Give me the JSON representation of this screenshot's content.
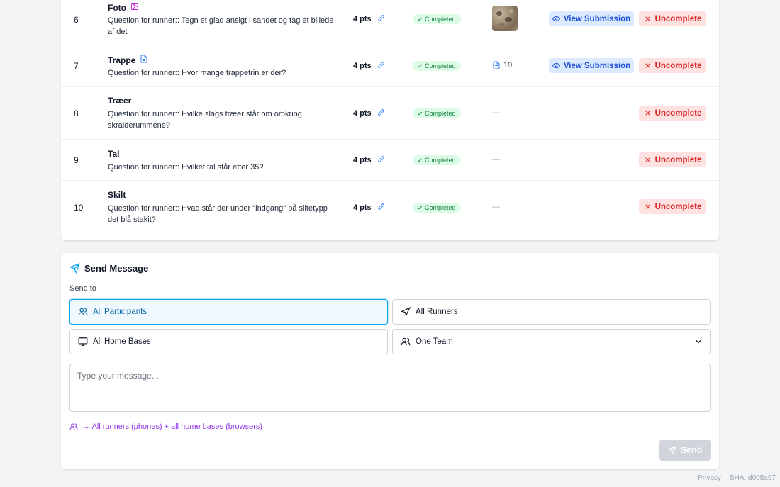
{
  "tasks": [
    {
      "number": "6",
      "title": "Foto",
      "type_icon": "image-icon",
      "question": "Question for runner:: Tegn et glad ansigt i sandet og tag et billede af det",
      "points": "4 pts",
      "status": "Completed",
      "submission_type": "photo-thumbnail",
      "submission_text": "",
      "view_label": "View Submission",
      "uncomplete_label": "Uncomplete"
    },
    {
      "number": "7",
      "title": "Trappe",
      "type_icon": "document-icon",
      "question": "Question for runner:: Hvor mange trappetrin er der?",
      "points": "4 pts",
      "status": "Completed",
      "submission_type": "text-answer",
      "submission_text": "19",
      "view_label": "View Submission",
      "uncomplete_label": "Uncomplete"
    },
    {
      "number": "8",
      "title": "Træer",
      "question": "Question for runner:: Hvilke slags træer står om omkring skralderummene?",
      "points": "4 pts",
      "status": "Completed",
      "submission_type": "none",
      "submission_text": "—",
      "uncomplete_label": "Uncomplete"
    },
    {
      "number": "9",
      "title": "Tal",
      "question": "Question for runner:: Hvilket tal står efter 35?",
      "points": "4 pts",
      "status": "Completed",
      "submission_type": "none",
      "submission_text": "—",
      "uncomplete_label": "Uncomplete"
    },
    {
      "number": "10",
      "title": "Skilt",
      "question": "Question for runner:: Hvad står der under \"indgang\" på slitetypp det blå stakit?",
      "points": "4 pts",
      "status": "Completed",
      "submission_type": "none",
      "submission_text": "—",
      "uncomplete_label": "Uncomplete"
    }
  ],
  "message": {
    "title": "Send Message",
    "send_to_label": "Send to",
    "options": {
      "all_participants": "All Participants",
      "all_runners": "All Runners",
      "all_home_bases": "All Home Bases",
      "one_team": "One Team"
    },
    "selected_option": "all_participants",
    "placeholder": "Type your message...",
    "value": "",
    "recipients_hint": "→ All runners (phones) + all home bases (browsers)",
    "send_label": "Send"
  },
  "footer": {
    "privacy": "Privacy",
    "sha": "SHA: d005a97"
  },
  "colors": {
    "primary": "#0ea5e9",
    "success_bg": "#dcfce7",
    "success_text": "#15803d",
    "danger_bg": "#fee2e2",
    "danger_text": "#dc2626",
    "info_bg": "#dbeafe",
    "info_text": "#1d4ed8",
    "hint": "#9333ea"
  }
}
